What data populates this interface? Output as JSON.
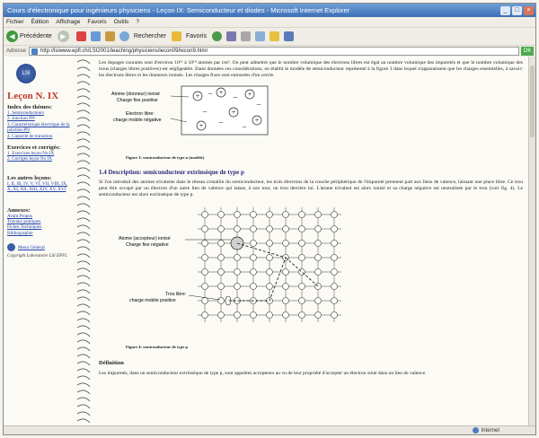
{
  "window": {
    "title": "Cours d'électronique pour ingénieurs physiciens - Leçon IX: Semiconducteur et diodes - Microsoft Internet Explorer"
  },
  "menu": [
    "Fichier",
    "Édition",
    "Affichage",
    "Favoris",
    "Outils",
    "?"
  ],
  "toolbar": {
    "back": "Précédente",
    "search": "Rechercher",
    "favorites": "Favoris"
  },
  "address": {
    "label": "Adresse",
    "url": "http://lsiwww.epfl.ch/LSI2001/teaching/physiciens/lecon09/lecon9.html",
    "go": "OK"
  },
  "sidebar": {
    "title": "Leçon N. IX",
    "index_heading": "Index des thèmes:",
    "index_items": [
      "1. Semiconducteurs",
      "2. Jonction PN",
      "3. Caractéristique électrique de la jonction PN",
      "4. Capacité de transition"
    ],
    "exercises_heading": "Exercices et corrigés:",
    "exercise_items": [
      "1. Exercices leçon No IX",
      "2. Corrigés leçon No IX"
    ],
    "others_heading": "Les autres leçons:",
    "lessons_links": "I, II, III, IV, V, VI, VII, VIII, IX, X, XI, XII, XIII, XIV, XV, XVI",
    "annex_heading": "Annexes:",
    "annex_items": [
      "Avant Propos",
      "Travaux pratiques",
      "Fiches Techniques",
      "Bibliographie"
    ],
    "menu_general": "Menu Général",
    "copyright": "Copyright Laboratoire LSI EPFL"
  },
  "content": {
    "para1": "Les dopages courants sont d'environ 10¹⁶ à 10¹⁸ atomes par cm³. On peut admettre que le nombre volumique des électrons libres est égal au nombre volumique des impuretés et que le nombre volumique des trous (charges libres positives) est négligeable. Etant données ces considérations, on établit le modèle de semiconducteur représenté à la figure 3 dans lequel n'apparaissent que les charges essentielles, à savoir: les électrons libres et les donneurs ionisés. Les charges fixes sont entourées d'un cercle.",
    "fig3_label1": "Atome (donneur) ionisé\nCharge fixe positive",
    "fig3_label2": "Electron libre:\ncharge mobile négative",
    "fig3_caption": "Figure 3: semiconducteur de type n (modèle)",
    "section": "1.4  Description: semiconducteur extrinsèque de type p",
    "para2": "Si l'on introduit des atomes trivalents dans le réseau cristallin du semiconducteur, les trois électrons de la couche périphérique de l'impureté prennent part aux liens de valence, laissant une place libre. Ce trou peut être occupé par un électron d'un autre lien de valence qui laisse, à son tour, un trou derrière lui. L'atome trivalent est alors ionisé et sa charge négative est neutralisée par le trou (voir fig. 4). Le semiconducteur est alors extrinsèque de type p.",
    "fig4_label1": "Atome (accepteur) ionisé\nCharge fixe négative",
    "fig4_label2": "Trou libre:\ncharge mobile positive",
    "fig4_caption": "Figure 4: semiconducteur de type p",
    "definition_title": "Définition",
    "para3": "Les impuretés, dans un semiconducteur extrinsèque de type p, sont appelées accepteurs au vu de leur propriété d'accepter un électron situé dans un lien de valence."
  },
  "status": {
    "zone": "Internet"
  }
}
